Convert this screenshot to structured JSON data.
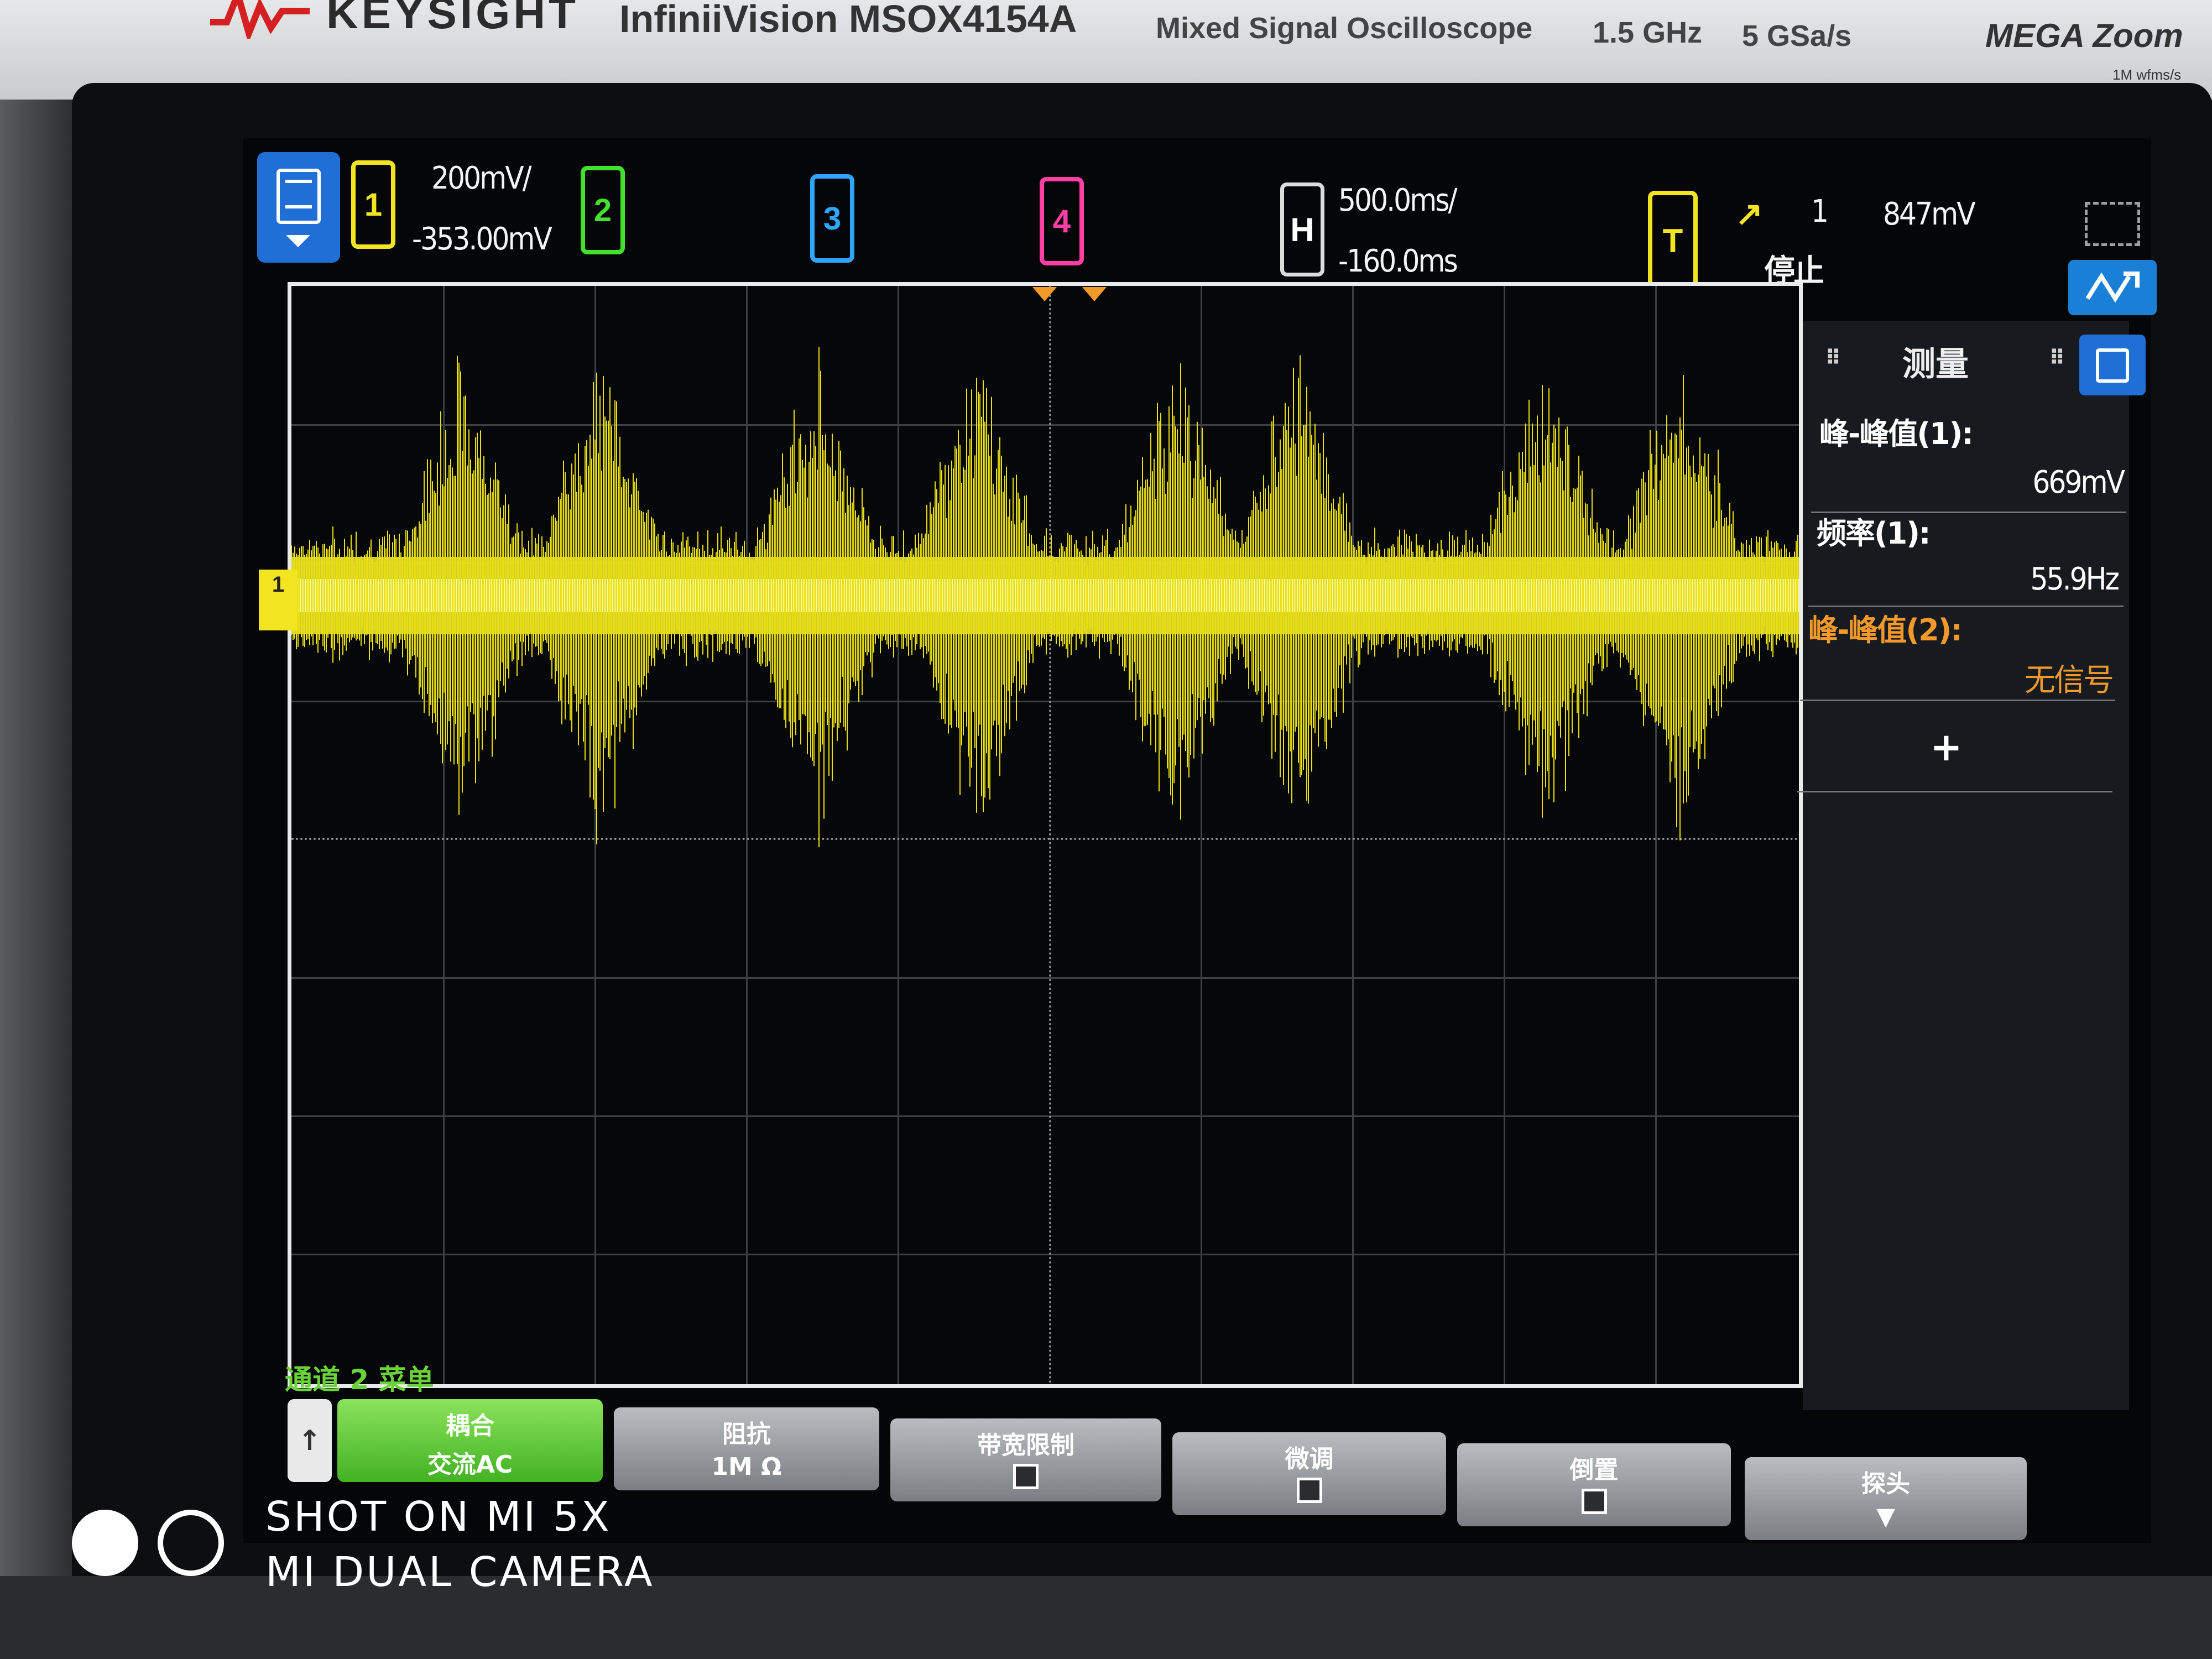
{
  "instrument": {
    "brand": "KEYSIGHT",
    "model": "InfiniiVision MSOX4154A",
    "description": "Mixed Signal Oscilloscope",
    "bandwidth": "1.5 GHz",
    "sample_rate": "5 GSa/s",
    "megazoom": "MEGA Zoom",
    "megazoom_sub": "1M wfms/s"
  },
  "status_bar": {
    "channels": [
      {
        "label": "1",
        "color": "#f2e41f"
      },
      {
        "label": "2",
        "color": "#43e02e"
      },
      {
        "label": "3",
        "color": "#2ea6ff"
      },
      {
        "label": "4",
        "color": "#ff3fa6"
      }
    ],
    "ch1_scale": "200mV/",
    "ch1_offset": "-353.00mV",
    "horizontal_label": "H",
    "time_scale": "500.0ms/",
    "time_delay": "-160.0ms",
    "trigger_label": "T",
    "trigger_source": "1",
    "trigger_level": "847mV",
    "run_state": "停止"
  },
  "measurements": {
    "title": "测量",
    "items": [
      {
        "label": "峰-峰值(1):",
        "value": "669mV"
      },
      {
        "label": "频率(1):",
        "value": "55.9Hz"
      },
      {
        "label": "峰-峰值(2):",
        "value": "无信号"
      }
    ],
    "add_label": "+"
  },
  "softkeys": {
    "menu_title": "通道 2 菜单",
    "back_icon": "↑",
    "coupling": {
      "label": "耦合",
      "value": "交流AC"
    },
    "impedance": {
      "label": "阻抗",
      "value": "1M Ω"
    },
    "bw_limit": {
      "label": "带宽限制"
    },
    "fine": {
      "label": "微调"
    },
    "invert": {
      "label": "倒置"
    },
    "probe": {
      "label": "探头"
    }
  },
  "camera": {
    "line1": "SHOT ON MI 5X",
    "line2": "MI DUAL CAMERA"
  }
}
